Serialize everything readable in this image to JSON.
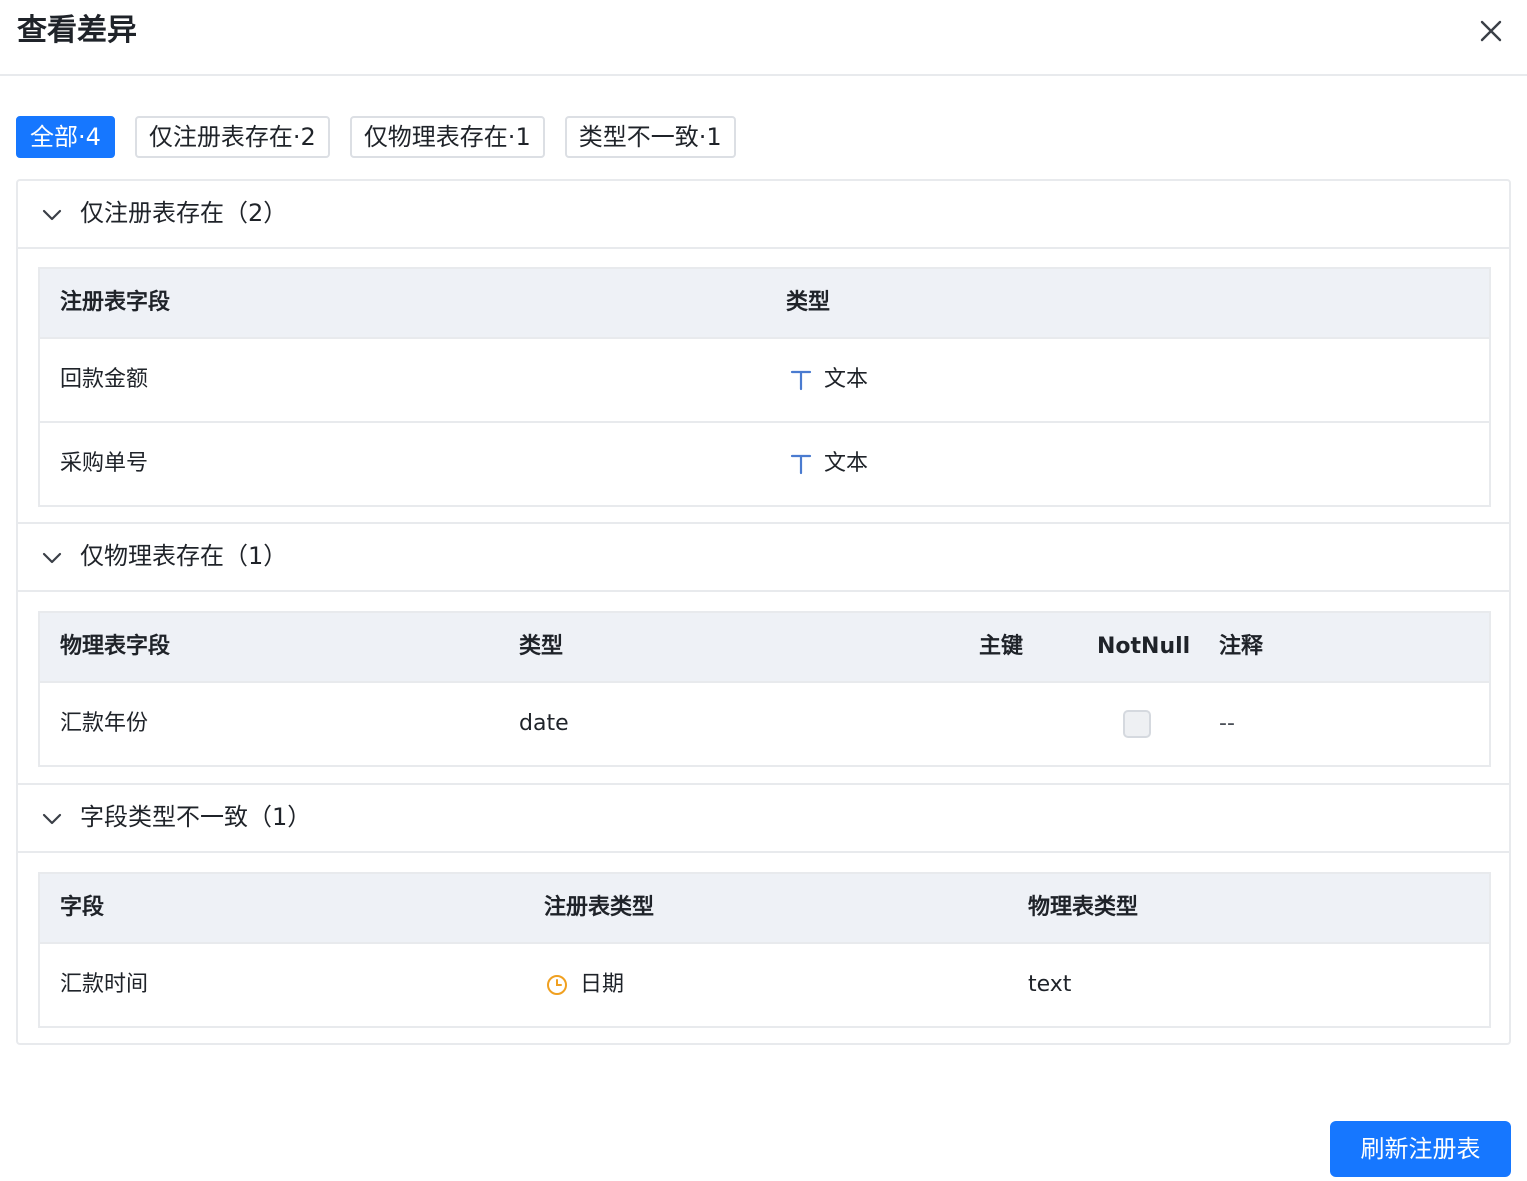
{
  "dialog": {
    "title": "查看差异"
  },
  "filters": [
    {
      "label": "全部·4",
      "active": true
    },
    {
      "label": "仅注册表存在·2",
      "active": false
    },
    {
      "label": "仅物理表存在·1",
      "active": false
    },
    {
      "label": "类型不一致·1",
      "active": false
    }
  ],
  "sections": {
    "registry_only": {
      "title": "仅注册表存在（2）",
      "columns": [
        "注册表字段",
        "类型"
      ],
      "rows": [
        {
          "field": "回款金额",
          "type": "文本",
          "type_icon": "text-type-icon"
        },
        {
          "field": "采购单号",
          "type": "文本",
          "type_icon": "text-type-icon"
        }
      ]
    },
    "physical_only": {
      "title": "仅物理表存在（1）",
      "columns": [
        "物理表字段",
        "类型",
        "主键",
        "NotNull",
        "注释"
      ],
      "rows": [
        {
          "field": "汇款年份",
          "type": "date",
          "primary_key": "",
          "not_null": false,
          "comment": "--"
        }
      ]
    },
    "type_mismatch": {
      "title": "字段类型不一致（1）",
      "columns": [
        "字段",
        "注册表类型",
        "物理表类型"
      ],
      "rows": [
        {
          "field": "汇款时间",
          "registry_type": "日期",
          "registry_type_icon": "clock-icon",
          "physical_type": "text"
        }
      ]
    }
  },
  "footer": {
    "refresh_label": "刷新注册表"
  },
  "colors": {
    "primary": "#1677ff",
    "table_header_bg": "#eef1f6",
    "border": "#e8eaed",
    "text_type_icon": "#4a7bd0",
    "date_type_icon": "#f0a020"
  }
}
